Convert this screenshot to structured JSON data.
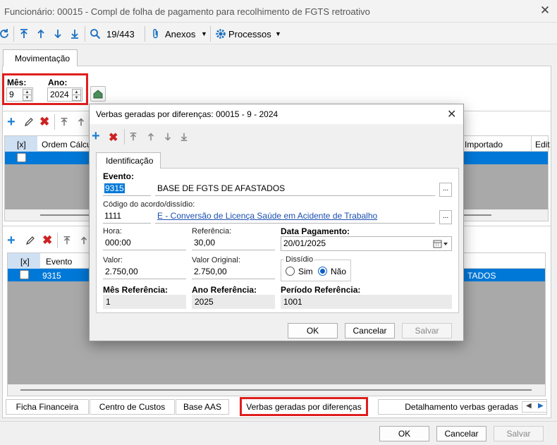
{
  "window": {
    "title": "Funcionário: 00015 - Compl de folha de pagamento para recolhimento de FGTS retroativo",
    "close": "✕"
  },
  "toolbar": {
    "record_pos": "19/443",
    "anexos": "Anexos",
    "processos": "Processos"
  },
  "tabs_top": {
    "movimentacao": "Movimentação"
  },
  "period": {
    "mes_label": "Mês:",
    "mes_value": "9",
    "ano_label": "Ano:",
    "ano_value": "2024"
  },
  "grid_top": {
    "col_check": "[x]",
    "col_ordem": "Ordem Cálculo",
    "col_importado": "Importado",
    "col_edit": "Edit"
  },
  "grid_bottom": {
    "col_check": "[x]",
    "col_evento": "Evento",
    "row_evento": "9315",
    "row_desc_fragment": "TADOS"
  },
  "bottom_tabs": [
    "Ficha Financeira",
    "Centro de Custos",
    "Base AAS",
    "Verbas geradas por diferenças",
    "Detalhamento verbas geradas"
  ],
  "main_buttons": {
    "ok": "OK",
    "cancel": "Cancelar",
    "save": "Salvar"
  },
  "dialog": {
    "title": "Verbas geradas por diferenças: 00015 - 9 - 2024",
    "close": "✕",
    "tab": "Identificação",
    "evento_label": "Evento:",
    "evento_code": "9315",
    "evento_desc": "BASE DE FGTS DE AFASTADOS",
    "acordo_label": "Código do acordo/dissídio:",
    "acordo_code": "1111",
    "acordo_desc": "E - Conversão de Licença Saúde em Acidente de Trabalho",
    "hora_label": "Hora:",
    "hora_value": "000:00",
    "referencia_label": "Referência:",
    "referencia_value": "30,00",
    "data_label": "Data Pagamento:",
    "data_value": "20/01/2025",
    "valor_label": "Valor:",
    "valor_value": "2.750,00",
    "valor_orig_label": "Valor Original:",
    "valor_orig_value": "2.750,00",
    "dissidio_label": "Dissídio",
    "sim": "Sim",
    "nao": "Não",
    "dissidio_selected": "Não",
    "mes_ref_label": "Mês Referência:",
    "mes_ref_value": "1",
    "ano_ref_label": "Ano Referência:",
    "ano_ref_value": "2025",
    "periodo_ref_label": "Período Referência:",
    "periodo_ref_value": "1001",
    "btn_ok": "OK",
    "btn_cancel": "Cancelar",
    "btn_save": "Salvar"
  },
  "colors": {
    "accent": "#0078d7",
    "highlight_box": "#e01e1e",
    "add_green": "#1f7fd0",
    "delete_red": "#cc2222"
  }
}
